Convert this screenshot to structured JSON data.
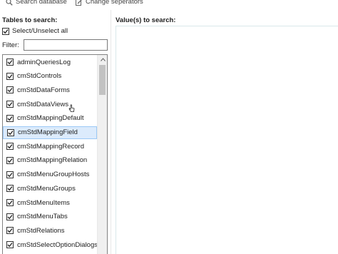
{
  "toolbar": {
    "search_database_label": "Search database",
    "change_separators_label": "Change seperators"
  },
  "left_panel": {
    "header": "Tables to search:",
    "select_all_label": "Select/Unselect all",
    "select_all_checked": true,
    "filter_label": "Filter:",
    "filter_value": "",
    "items": [
      {
        "label": "adminQueriesLog",
        "checked": true,
        "selected": false
      },
      {
        "label": "cmStdControls",
        "checked": true,
        "selected": false
      },
      {
        "label": "cmStdDataForms",
        "checked": true,
        "selected": false
      },
      {
        "label": "cmStdDataViews",
        "checked": true,
        "selected": false
      },
      {
        "label": "cmStdMappingDefault",
        "checked": true,
        "selected": false
      },
      {
        "label": "cmStdMappingField",
        "checked": true,
        "selected": true
      },
      {
        "label": "cmStdMappingRecord",
        "checked": true,
        "selected": false
      },
      {
        "label": "cmStdMappingRelation",
        "checked": true,
        "selected": false
      },
      {
        "label": "cmStdMenuGroupHosts",
        "checked": true,
        "selected": false
      },
      {
        "label": "cmStdMenuGroups",
        "checked": true,
        "selected": false
      },
      {
        "label": "cmStdMenuItems",
        "checked": true,
        "selected": false
      },
      {
        "label": "cmStdMenuTabs",
        "checked": true,
        "selected": false
      },
      {
        "label": "cmStdRelations",
        "checked": true,
        "selected": false
      },
      {
        "label": "cmStdSelectOptionDialogs",
        "checked": true,
        "selected": false
      }
    ]
  },
  "right_panel": {
    "header": "Value(s) to search:",
    "value": ""
  },
  "icons": {
    "search": "search-icon",
    "separators": "edit-icon",
    "checkmark": "checkmark-icon",
    "scroll_up": "chevron-up-icon",
    "cursor": "hand-cursor-icon"
  },
  "colors": {
    "selected_row": "#dcebfc",
    "selected_border": "#9cc9f6",
    "values_border": "#d8e8ea"
  }
}
